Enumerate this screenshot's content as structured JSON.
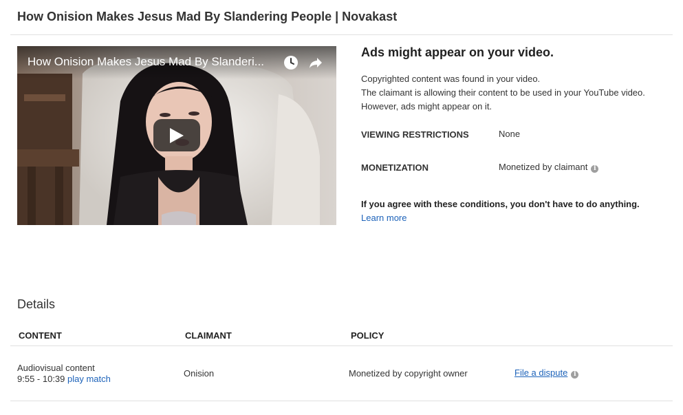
{
  "header": {
    "title": "How Onision Makes Jesus Mad By Slandering People | Novakast"
  },
  "video": {
    "title": "How Onision Makes Jesus Mad By Slanderi...",
    "watch_later_icon": "clock-icon",
    "share_icon": "share-arrow-icon",
    "play_icon": "play-icon"
  },
  "claim": {
    "heading": "Ads might appear on your video.",
    "description": [
      "Copyrighted content was found in your video.",
      "The claimant is allowing their content to be used in your YouTube video.",
      "However, ads might appear on it."
    ],
    "viewing_restrictions": {
      "label": "VIEWING RESTRICTIONS",
      "value": "None"
    },
    "monetization": {
      "label": "MONETIZATION",
      "value": "Monetized by claimant"
    },
    "agree_text": "If you agree with these conditions, you don't have to do anything.",
    "learn_more": "Learn more"
  },
  "details": {
    "heading": "Details",
    "columns": [
      "CONTENT",
      "CLAIMANT",
      "POLICY"
    ],
    "rows": [
      {
        "content_type": "Audiovisual content",
        "time_range": "9:55 - 10:39",
        "play_match": "play match",
        "claimant": "Onision",
        "policy": "Monetized by copyright owner",
        "action": "File a dispute"
      }
    ]
  },
  "colors": {
    "link": "#1c62b9",
    "divider": "#e0e0e0",
    "icon_grey": "#9e9e9e"
  }
}
